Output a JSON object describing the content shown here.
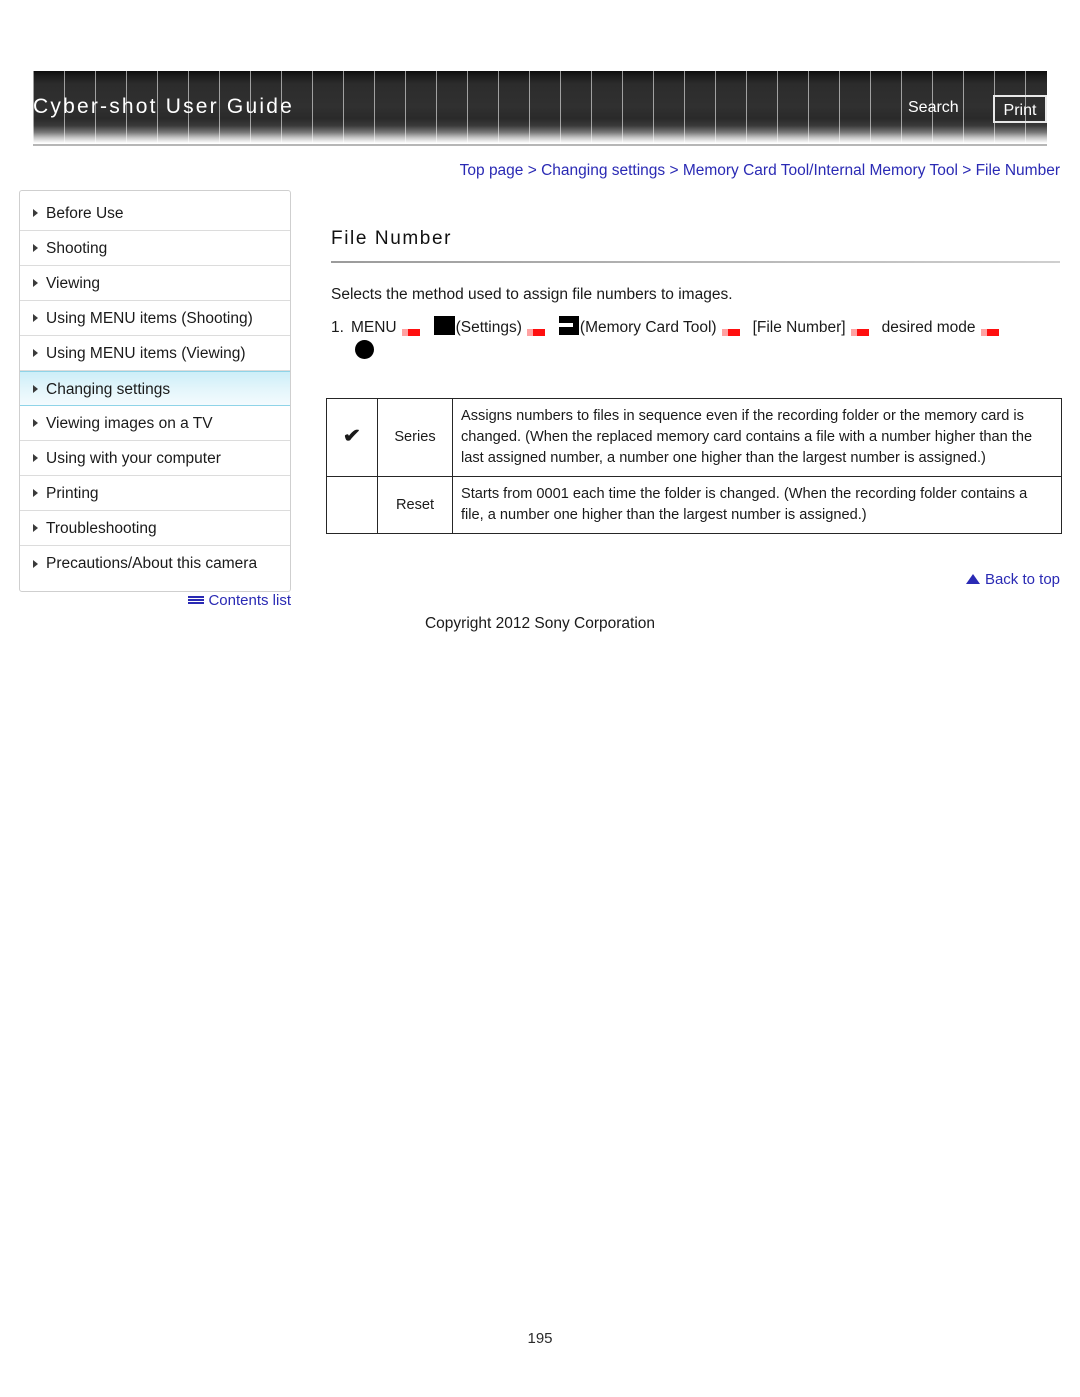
{
  "header": {
    "title": "Cyber-shot User Guide",
    "search_label": "Search",
    "print_label": "Print"
  },
  "breadcrumb": {
    "text": "Top page > Changing settings > Memory Card Tool/Internal Memory Tool > File Number"
  },
  "sidebar": {
    "items": [
      {
        "label": "Before Use",
        "active": false
      },
      {
        "label": "Shooting",
        "active": false
      },
      {
        "label": "Viewing",
        "active": false
      },
      {
        "label": "Using MENU items (Shooting)",
        "active": false
      },
      {
        "label": "Using MENU items (Viewing)",
        "active": false
      },
      {
        "label": "Changing settings",
        "active": true
      },
      {
        "label": "Viewing images on a TV",
        "active": false
      },
      {
        "label": "Using with your computer",
        "active": false
      },
      {
        "label": "Printing",
        "active": false
      },
      {
        "label": "Troubleshooting",
        "active": false
      },
      {
        "label": "Precautions/About this camera",
        "active": false
      }
    ],
    "contents_list_label": "Contents list"
  },
  "main": {
    "title": "File Number",
    "intro": "Selects the method used to assign file numbers to images.",
    "step": {
      "number": "1.",
      "frag_menu": "MENU",
      "frag_settings": "(Settings)",
      "frag_memcard": "(Memory Card Tool)",
      "frag_filenumber": "[File Number]",
      "frag_desired": "desired mode"
    },
    "table": {
      "rows": [
        {
          "checked": "✔",
          "name": "Series",
          "description": "Assigns numbers to files in sequence even if the recording folder or the memory card is changed. (When the replaced memory card contains a file with a number higher than the last assigned number, a number one higher than the largest number is assigned.)"
        },
        {
          "checked": "",
          "name": "Reset",
          "description": "Starts from 0001 each time the folder is changed. (When the recording folder contains a file, a number one higher than the largest number is assigned.)"
        }
      ]
    }
  },
  "footer": {
    "back_to_top_label": "Back to top",
    "copyright": "Copyright 2012 Sony Corporation",
    "page_number": "195"
  },
  "colors": {
    "link": "#2a2ab4",
    "arrow": "#ff0f0f",
    "active_nav": "#cdeef8"
  }
}
